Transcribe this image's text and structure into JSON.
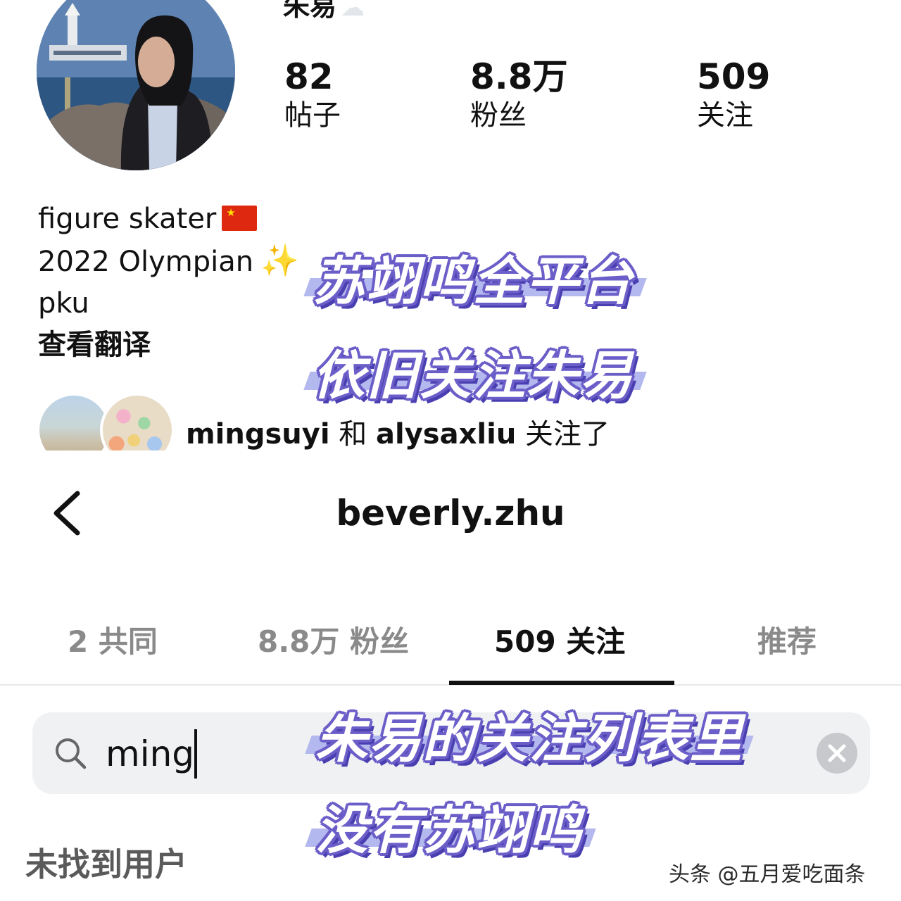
{
  "profile": {
    "display_name": "朱易",
    "stats": [
      {
        "value": "82",
        "label": "帖子"
      },
      {
        "value": "8.8万",
        "label": "粉丝"
      },
      {
        "value": "509",
        "label": "关注"
      }
    ],
    "bio": {
      "line1": "figure skater",
      "line2": "2022 Olympian",
      "line3": "pku",
      "translate_link": "查看翻译"
    },
    "followed_by": {
      "user1": "mingsuyi",
      "joiner": "和",
      "user2": "alysaxliu",
      "suffix": "关注了"
    }
  },
  "captions": [
    "苏翊鸣全平台",
    "依旧关注朱易",
    "朱易的关注列表里",
    "没有苏翊鸣"
  ],
  "following_page": {
    "title": "beverly.zhu",
    "tabs": [
      {
        "label": "2 共同",
        "active": false
      },
      {
        "label": "8.8万 粉丝",
        "active": false
      },
      {
        "label": "509 关注",
        "active": true
      },
      {
        "label": "推荐",
        "active": false
      }
    ],
    "search": {
      "value": "ming"
    },
    "empty_message": "未找到用户"
  },
  "watermark": "头条 @五月爱吃面条",
  "colors": {
    "caption_outline": "#6b5ec8",
    "caption_bar": "#b3b8ef",
    "search_bg": "#eff1f3"
  },
  "icons": [
    "back-chevron-icon",
    "search-icon",
    "clear-icon",
    "cloud-icon",
    "china-flag-icon",
    "sparkles-icon"
  ]
}
